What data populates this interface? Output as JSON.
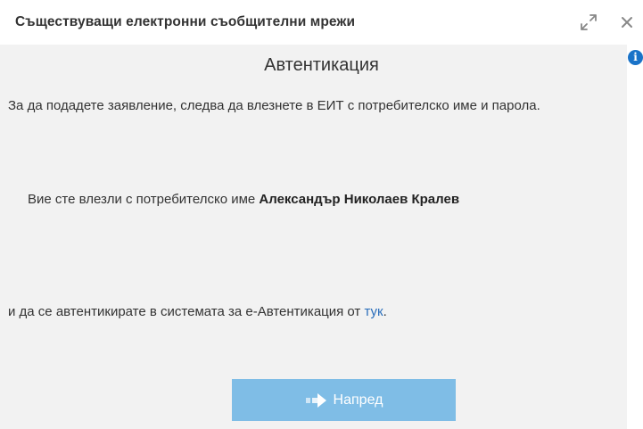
{
  "dialog": {
    "title": "Съществуващи електронни съобщителни мрежи",
    "maximize_icon": "maximize-icon",
    "close_icon": "close-icon",
    "info_icon": "info-icon",
    "info_glyph": "i"
  },
  "auth": {
    "heading": "Автентикация",
    "intro": "За да подадете заявление, следва да влезнете в ЕИТ с потребителско име и парола.",
    "logged_in_prefix": "Вие сте влезли с потребителско име ",
    "user_name": "Александър Николаев Кралев",
    "auth_text": "и да се автентикирате в системата за е-Автентикация от ",
    "auth_link": "тук",
    "auth_suffix": ".",
    "next_button": "Напред",
    "next_icon": "arrow-right-icon"
  },
  "colors": {
    "content_bg": "#f2f2f2",
    "button_bg": "#7fbde6",
    "link": "#2a6ebb",
    "info_icon_bg": "#1a73c8"
  }
}
